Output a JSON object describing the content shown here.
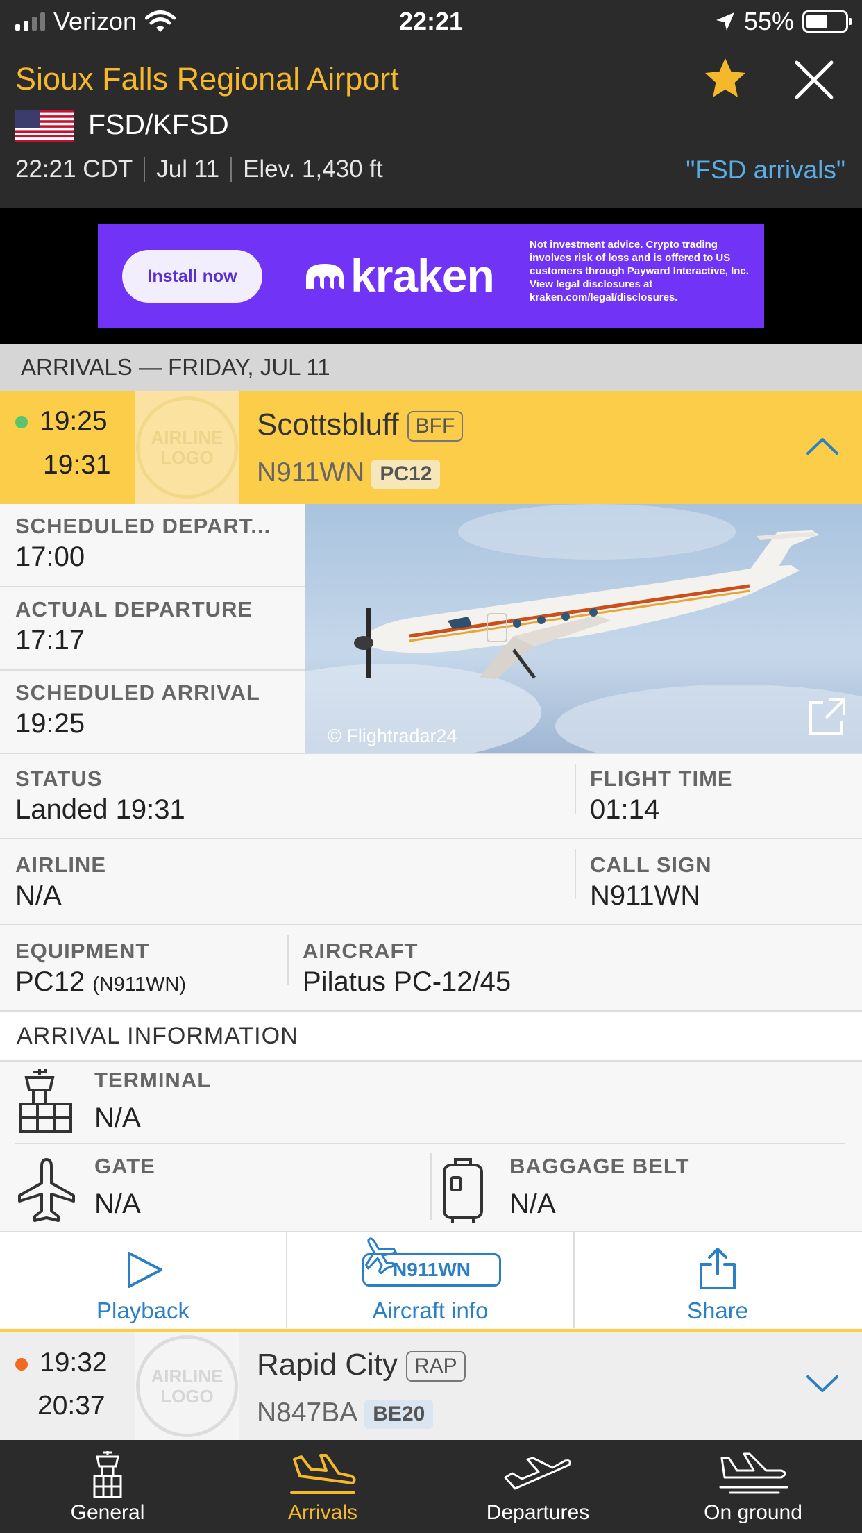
{
  "status_bar": {
    "carrier": "Verizon",
    "time": "22:21",
    "battery": "55%",
    "battery_level": 0.55
  },
  "airport": {
    "name": "Sioux Falls Regional Airport",
    "codes": "FSD/KFSD",
    "local_time": "22:21 CDT",
    "date": "Jul 11",
    "elevation": "Elev. 1,430 ft",
    "arrivals_link": "\"FSD arrivals\""
  },
  "ad": {
    "install_label": "Install now",
    "brand": "kraken",
    "disclaimer": "Not investment advice. Crypto trading involves risk of loss and is offered to US customers through Payward Interactive, Inc. View legal disclosures at kraken.com/legal/disclosures."
  },
  "section_header": "ARRIVALS — FRIDAY, JUL 11",
  "flights": [
    {
      "scheduled": "19:25",
      "actual": "19:31",
      "status_color": "#5cc46e",
      "logo_text": [
        "AIRLINE",
        "LOGO"
      ],
      "origin": "Scottsbluff",
      "iata": "BFF",
      "registration": "N911WN",
      "aircraft_type": "PC12"
    },
    {
      "scheduled": "19:32",
      "actual": "20:37",
      "status_color": "#f06a22",
      "logo_text": [
        "AIRLINE",
        "LOGO"
      ],
      "origin": "Rapid City",
      "iata": "RAP",
      "registration": "N847BA",
      "aircraft_type": "BE20"
    }
  ],
  "details": {
    "scheduled_departure": {
      "label": "SCHEDULED DEPART...",
      "value": "17:00"
    },
    "actual_departure": {
      "label": "ACTUAL DEPARTURE",
      "value": "17:17"
    },
    "scheduled_arrival": {
      "label": "SCHEDULED ARRIVAL",
      "value": "19:25"
    },
    "photo_credit": "© Flightradar24",
    "status": {
      "label": "STATUS",
      "value": "Landed 19:31"
    },
    "flight_time": {
      "label": "FLIGHT TIME",
      "value": "01:14"
    },
    "airline": {
      "label": "AIRLINE",
      "value": "N/A"
    },
    "call_sign": {
      "label": "CALL SIGN",
      "value": "N911WN"
    },
    "equipment": {
      "label": "EQUIPMENT",
      "value": "PC12",
      "sub": "(N911WN)"
    },
    "aircraft": {
      "label": "AIRCRAFT",
      "value": "Pilatus PC-12/45"
    }
  },
  "arrival_info": {
    "header": "ARRIVAL INFORMATION",
    "terminal": {
      "label": "TERMINAL",
      "value": "N/A"
    },
    "gate": {
      "label": "GATE",
      "value": "N/A"
    },
    "baggage": {
      "label": "BAGGAGE BELT",
      "value": "N/A"
    }
  },
  "actions": {
    "playback": "Playback",
    "aircraft_info": "Aircraft info",
    "aircraft_reg": "N911WN",
    "share": "Share"
  },
  "tabs": [
    {
      "label": "General",
      "icon": "control-tower-icon"
    },
    {
      "label": "Arrivals",
      "icon": "plane-landing-icon"
    },
    {
      "label": "Departures",
      "icon": "plane-takeoff-icon"
    },
    {
      "label": "On ground",
      "icon": "plane-on-ground-icon"
    }
  ],
  "colors": {
    "accent": "#f5b82b",
    "highlight_row": "#fbcd48",
    "link": "#2b7fc4",
    "ad_background": "#7133f6"
  }
}
